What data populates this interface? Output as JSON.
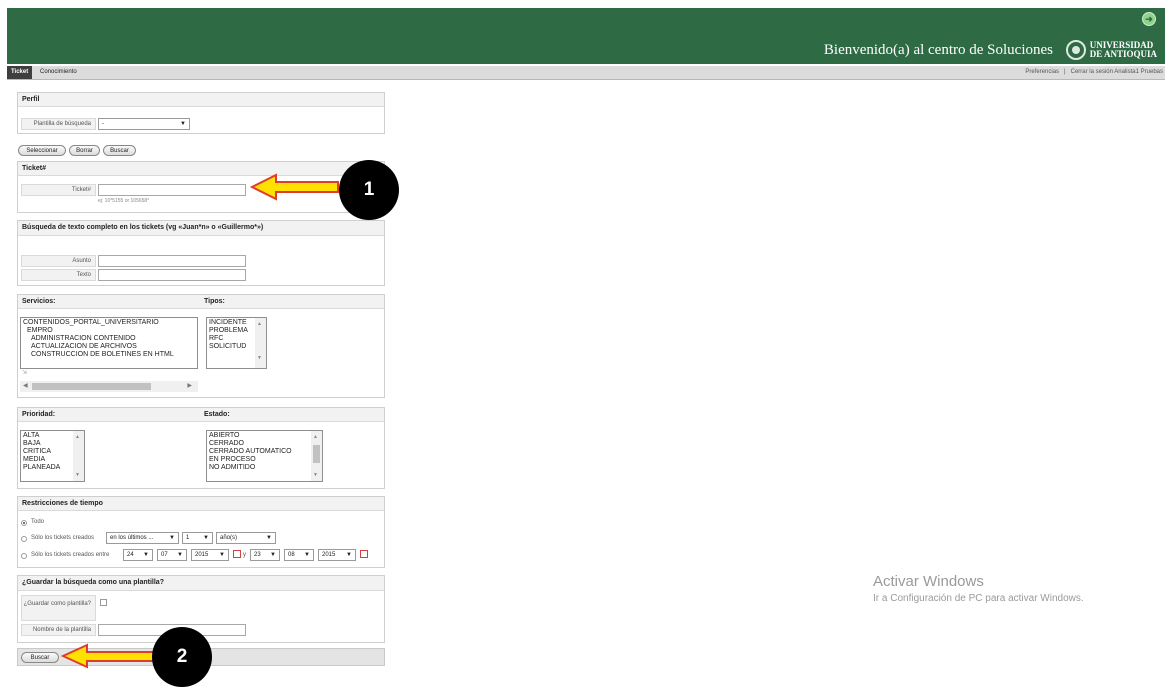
{
  "header": {
    "welcome": "Bienvenido(a) al centro de Soluciones",
    "logo_line1": "UNIVERSIDAD",
    "logo_line2": "DE ANTIOQUIA"
  },
  "nav": {
    "tabs": [
      "Ticket",
      "Conocimiento"
    ],
    "right": [
      "Preferencias",
      "|",
      "Cerrar la sesión Analista1 Pruebas"
    ]
  },
  "perfil": {
    "title": "Perfil",
    "template_label": "Plantilla de búsqueda",
    "template_value": "-",
    "buttons": [
      "Seleccionar",
      "Borrar",
      "Buscar"
    ]
  },
  "ticket": {
    "title": "Ticket#",
    "field_label": "Ticket#",
    "hint": "ej: 10*5155 or 105658*"
  },
  "fulltext": {
    "title": "Búsqueda de texto completo en los tickets (vg «Juan*n» o «Guillermo*»)",
    "subject_label": "Asunto",
    "text_label": "Texto"
  },
  "servicios": {
    "title": "Servicios:",
    "items": [
      "CONTENIDOS_PORTAL_UNIVERSITARIO",
      "  EMPRO",
      "    ADMINISTRACION CONTENIDO",
      "    ACTUALIZACION DE ARCHIVOS",
      "    CONSTRUCCION DE BOLETINES EN HTML"
    ]
  },
  "tipos": {
    "title": "Tipos:",
    "items": [
      "INCIDENTE",
      "PROBLEMA",
      "RFC",
      "SOLICITUD"
    ]
  },
  "prioridad": {
    "title": "Prioridad:",
    "items": [
      "ALTA",
      "BAJA",
      "CRITICA",
      "MEDIA",
      "PLANEADA"
    ]
  },
  "estado": {
    "title": "Estado:",
    "items": [
      "ABIERTO",
      "CERRADO",
      "CERRADO AUTOMATICO",
      "EN PROCESO",
      "NO ADMITIDO"
    ]
  },
  "tiempo": {
    "title": "Restricciones de tiempo",
    "option_all": "Todo",
    "option_created": "Sólo los tickets creados",
    "created_range": "en los últimos ...",
    "created_num": "1",
    "created_unit": "año(s)",
    "option_between": "Sólo los tickets creados entre",
    "from_day": "24",
    "from_month": "07",
    "from_year": "2015",
    "and_label": "y",
    "to_day": "23",
    "to_month": "08",
    "to_year": "2015"
  },
  "guardar": {
    "title": "¿Guardar la búsqueda como una plantilla?",
    "save_label": "¿Guardar como plantilla?",
    "name_label": "Nombre de la plantilla"
  },
  "bottom": {
    "search_button": "Buscar"
  },
  "callouts": [
    "1",
    "2"
  ],
  "watermark": {
    "line1": "Activar Windows",
    "line2": "Ir a Configuración de PC para activar Windows."
  },
  "colors": {
    "header": "#2e6b45",
    "arrow": "#ffe100",
    "arrow_outline": "#e03c2d"
  }
}
